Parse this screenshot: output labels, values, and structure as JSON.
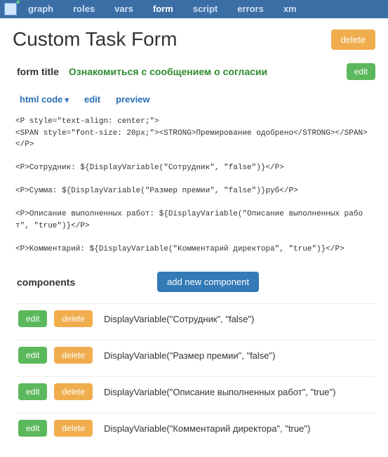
{
  "topbar": {
    "tabs": [
      "graph",
      "roles",
      "vars",
      "form",
      "script",
      "errors",
      "xm"
    ],
    "active_index": 3
  },
  "page": {
    "title": "Custom Task Form",
    "delete_label": "delete"
  },
  "form_title": {
    "label": "form title",
    "value": "Ознакомиться с сообщением о согласии",
    "edit_label": "edit"
  },
  "subnav": {
    "html_code": "html code",
    "edit": "edit",
    "preview": "preview"
  },
  "html_lines": [
    "<P style=\"text-align: center;\">",
    "<SPAN style=\"font-size: 20px;\"><STRONG>Премирование одобрено</STRONG></SPAN></P>",
    "",
    "<P>Сотрудник: ${DisplayVariable(\"Сотрудник\", \"false\")}</P>",
    "",
    "<P>Сумма: ${DisplayVariable(\"Размер премии\", \"false\")}руб</P>",
    "",
    "<P>Описание выполненных работ: ${DisplayVariable(\"Описание выполненных работ\", \"true\")}</P>",
    "",
    "<P>Комментарий: ${DisplayVariable(\"Комментарий директора\", \"true\")}</P>"
  ],
  "components_section": {
    "label": "components",
    "add_label": "add new component"
  },
  "components": [
    {
      "edit": "edit",
      "delete": "delete",
      "text": "DisplayVariable(\"Сотрудник\", \"false\")"
    },
    {
      "edit": "edit",
      "delete": "delete",
      "text": "DisplayVariable(\"Размер премии\", \"false\")"
    },
    {
      "edit": "edit",
      "delete": "delete",
      "text": "DisplayVariable(\"Описание выполненных работ\", \"true\")"
    },
    {
      "edit": "edit",
      "delete": "delete",
      "text": "DisplayVariable(\"Комментарий директора\", \"true\")"
    }
  ]
}
